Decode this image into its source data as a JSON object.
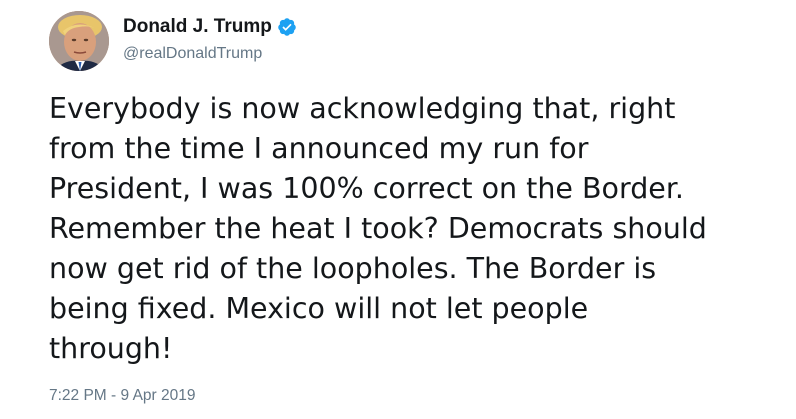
{
  "author": {
    "display_name": "Donald J. Trump",
    "handle": "@realDonaldTrump",
    "verified": true,
    "verified_color": "#1da1f2"
  },
  "tweet": {
    "lines": [
      "Everybody is now acknowledging that, right",
      "from the time I announced my run for",
      "President, I was 100% correct on the Border.",
      "Remember the heat I took? Democrats should",
      "now get rid of the loopholes. The Border is",
      "being fixed. Mexico will not let people",
      "through!"
    ],
    "timestamp": "7:22 PM - 9 Apr 2019"
  },
  "colors": {
    "text": "#14171a",
    "secondary": "#657786",
    "background": "#ffffff"
  }
}
